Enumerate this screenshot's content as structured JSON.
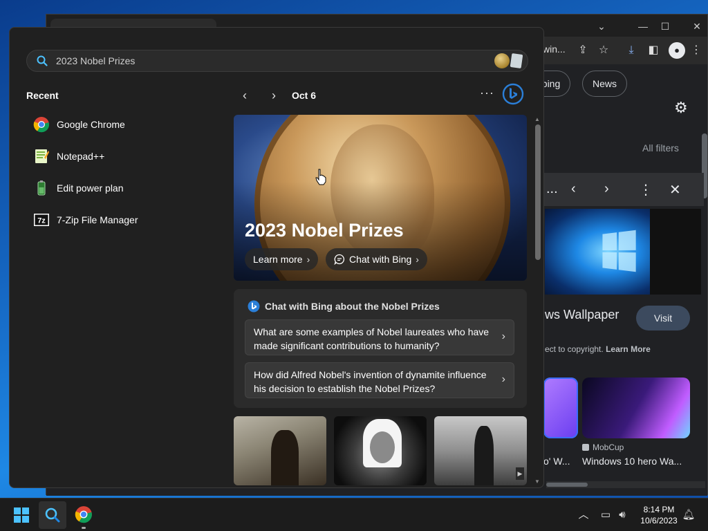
{
  "search": {
    "query": "2023 Nobel Prizes"
  },
  "recent": {
    "title": "Recent",
    "items": [
      {
        "label": "Google Chrome"
      },
      {
        "label": "Notepad++"
      },
      {
        "label": "Edit power plan"
      },
      {
        "label": "7-Zip File Manager"
      }
    ]
  },
  "nav": {
    "date": "Oct 6",
    "more": "···"
  },
  "hero": {
    "title": "2023 Nobel Prizes",
    "learn_more": "Learn more",
    "chat_with_bing": "Chat with Bing"
  },
  "chat": {
    "heading": "Chat with Bing about the Nobel Prizes",
    "suggestions": [
      "What are some examples of Nobel laureates who have made significant contributions to humanity?",
      "How did Alfred Nobel's invention of dynamite influence his decision to establish the Nobel Prizes?"
    ]
  },
  "chrome": {
    "omnibox_fragment": "win...",
    "chip_shopping": "pping",
    "chip_news": "News",
    "all_filters": "All filters",
    "wallpaper_title": "ws Wallpaper",
    "visit": "Visit",
    "copyright": "ect to copyright.",
    "learn_more": "Learn More",
    "related_source": "MobCup",
    "related_title": "Windows 10 hero Wa...",
    "related_title_left": "o' W..."
  },
  "taskbar": {
    "time": "8:14 PM",
    "date": "10/6/2023"
  },
  "colors": {
    "panel_bg": "#202020",
    "accent": "#4cc2ff",
    "bing_blue": "#2b7fd8"
  }
}
